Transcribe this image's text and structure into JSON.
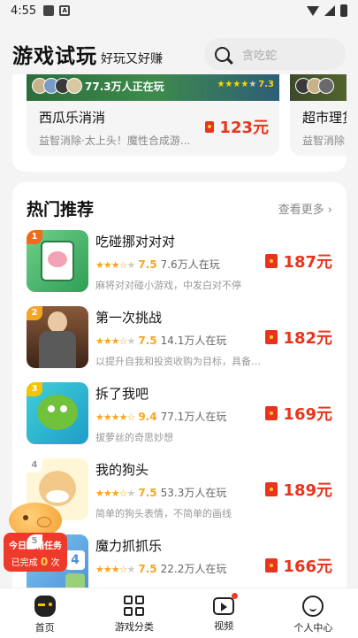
{
  "status": {
    "time": "4:55"
  },
  "header": {
    "title": "游戏试玩",
    "slogan": "好玩又好赚",
    "search_placeholder": "贪吃蛇"
  },
  "top_cards": [
    {
      "players": "77.3万人正在玩",
      "rating": "7.3",
      "name": "西瓜乐消消",
      "desc": "益智消除·太上头！魔性合成游...",
      "price": "123元"
    },
    {
      "name": "超市理货",
      "desc": "益智消除"
    }
  ],
  "hot": {
    "title": "热门推荐",
    "see_more": "查看更多 ›",
    "items": [
      {
        "rank": "1",
        "name": "吃碰挪对对对",
        "score": "7.5",
        "players": "7.6万人在玩",
        "desc": "麻将对对碰小游戏，中发白对不停",
        "price": "187元"
      },
      {
        "rank": "2",
        "name": "第一次挑战",
        "score": "7.5",
        "players": "14.1万人在玩",
        "desc": "以提升自我和投资收购为目标，具备十...",
        "price": "182元"
      },
      {
        "rank": "3",
        "name": "拆了我吧",
        "score": "9.4",
        "players": "77.1万人在玩",
        "desc": "拔萝丝的奇思妙想",
        "price": "169元"
      },
      {
        "rank": "4",
        "name": "我的狗头",
        "score": "7.5",
        "players": "53.3万人在玩",
        "desc": "简单的狗头表情，不简单的画线",
        "price": "189元"
      },
      {
        "rank": "5",
        "name": "魔力抓抓乐",
        "score": "7.5",
        "players": "22.2万人在玩",
        "desc": "",
        "price": "166元"
      }
    ]
  },
  "promo": {
    "line1": "今日宝箱任务",
    "done_prefix": "已完成",
    "done_count": "0",
    "done_suffix": "次"
  },
  "tabs": [
    {
      "label": "首页",
      "icon": "gamepad-icon"
    },
    {
      "label": "游戏分类",
      "icon": "grid-icon"
    },
    {
      "label": "视频",
      "icon": "video-icon"
    },
    {
      "label": "个人中心",
      "icon": "user-icon"
    }
  ],
  "colors": {
    "accent": "#e8341c",
    "star": "#f5a623",
    "tab_active": "#f5c400"
  }
}
